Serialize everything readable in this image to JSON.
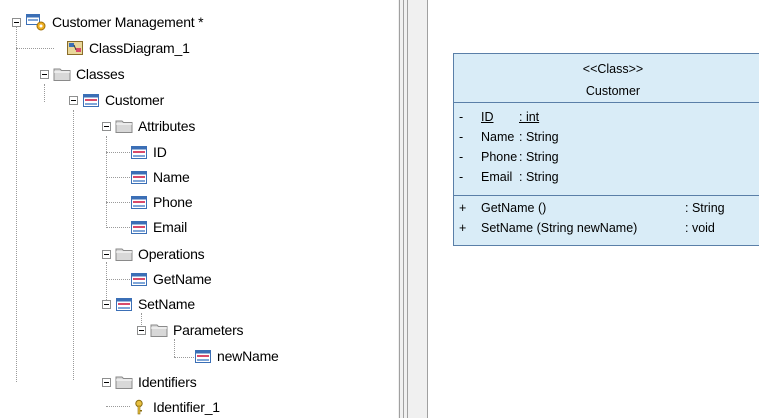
{
  "tree": {
    "root": "Customer Management *",
    "diagram": "ClassDiagram_1",
    "classes_folder": "Classes",
    "class_name": "Customer",
    "attributes_folder": "Attributes",
    "attributes": [
      "ID",
      "Name",
      "Phone",
      "Email"
    ],
    "operations_folder": "Operations",
    "operations": [
      "GetName",
      "SetName"
    ],
    "parameters_folder": "Parameters",
    "parameter": "newName",
    "identifiers_folder": "Identifiers",
    "identifier": "Identifier_1"
  },
  "diagram": {
    "stereotype": "<<Class>>",
    "class_name": "Customer",
    "attributes": [
      {
        "visibility": "-",
        "name": "ID",
        "type": ": int"
      },
      {
        "visibility": "-",
        "name": "Name",
        "type": ": String"
      },
      {
        "visibility": "-",
        "name": "Phone",
        "type": ": String"
      },
      {
        "visibility": "-",
        "name": "Email",
        "type": ": String"
      }
    ],
    "operations": [
      {
        "visibility": "+",
        "name": "GetName ()",
        "type": ": String"
      },
      {
        "visibility": "+",
        "name": "SetName (String newName)",
        "type": ": void"
      }
    ],
    "colors": {
      "box_fill": "#d9ecf7",
      "box_border": "#5a7fa8"
    }
  },
  "icons": {
    "model": "model-icon",
    "diagram": "class-diagram-icon",
    "folder": "folder-icon",
    "class": "class-icon",
    "attribute": "attribute-icon",
    "operation": "operation-icon",
    "parameter": "parameter-icon",
    "identifier": "key-icon"
  }
}
